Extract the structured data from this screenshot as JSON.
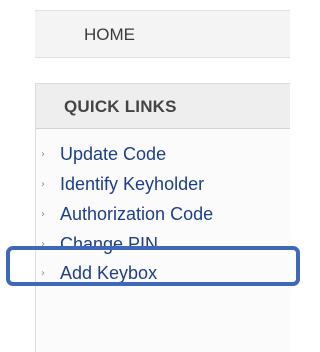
{
  "nav": {
    "home_label": "HOME"
  },
  "quick_links": {
    "title": "QUICK LINKS",
    "items": [
      {
        "label": "Update Code",
        "icon": "arrow-right-icon"
      },
      {
        "label": "Identify Keyholder",
        "icon": "arrow-right-icon"
      },
      {
        "label": "Authorization Code",
        "icon": "arrow-right-icon"
      },
      {
        "label": "Change PIN",
        "icon": "arrow-right-icon"
      },
      {
        "label": "Add Keybox",
        "icon": "arrow-right-icon"
      }
    ]
  },
  "colors": {
    "link": "#1d3f87",
    "highlight": "#3f68b8",
    "panel_bg": "#f4f4f4"
  }
}
